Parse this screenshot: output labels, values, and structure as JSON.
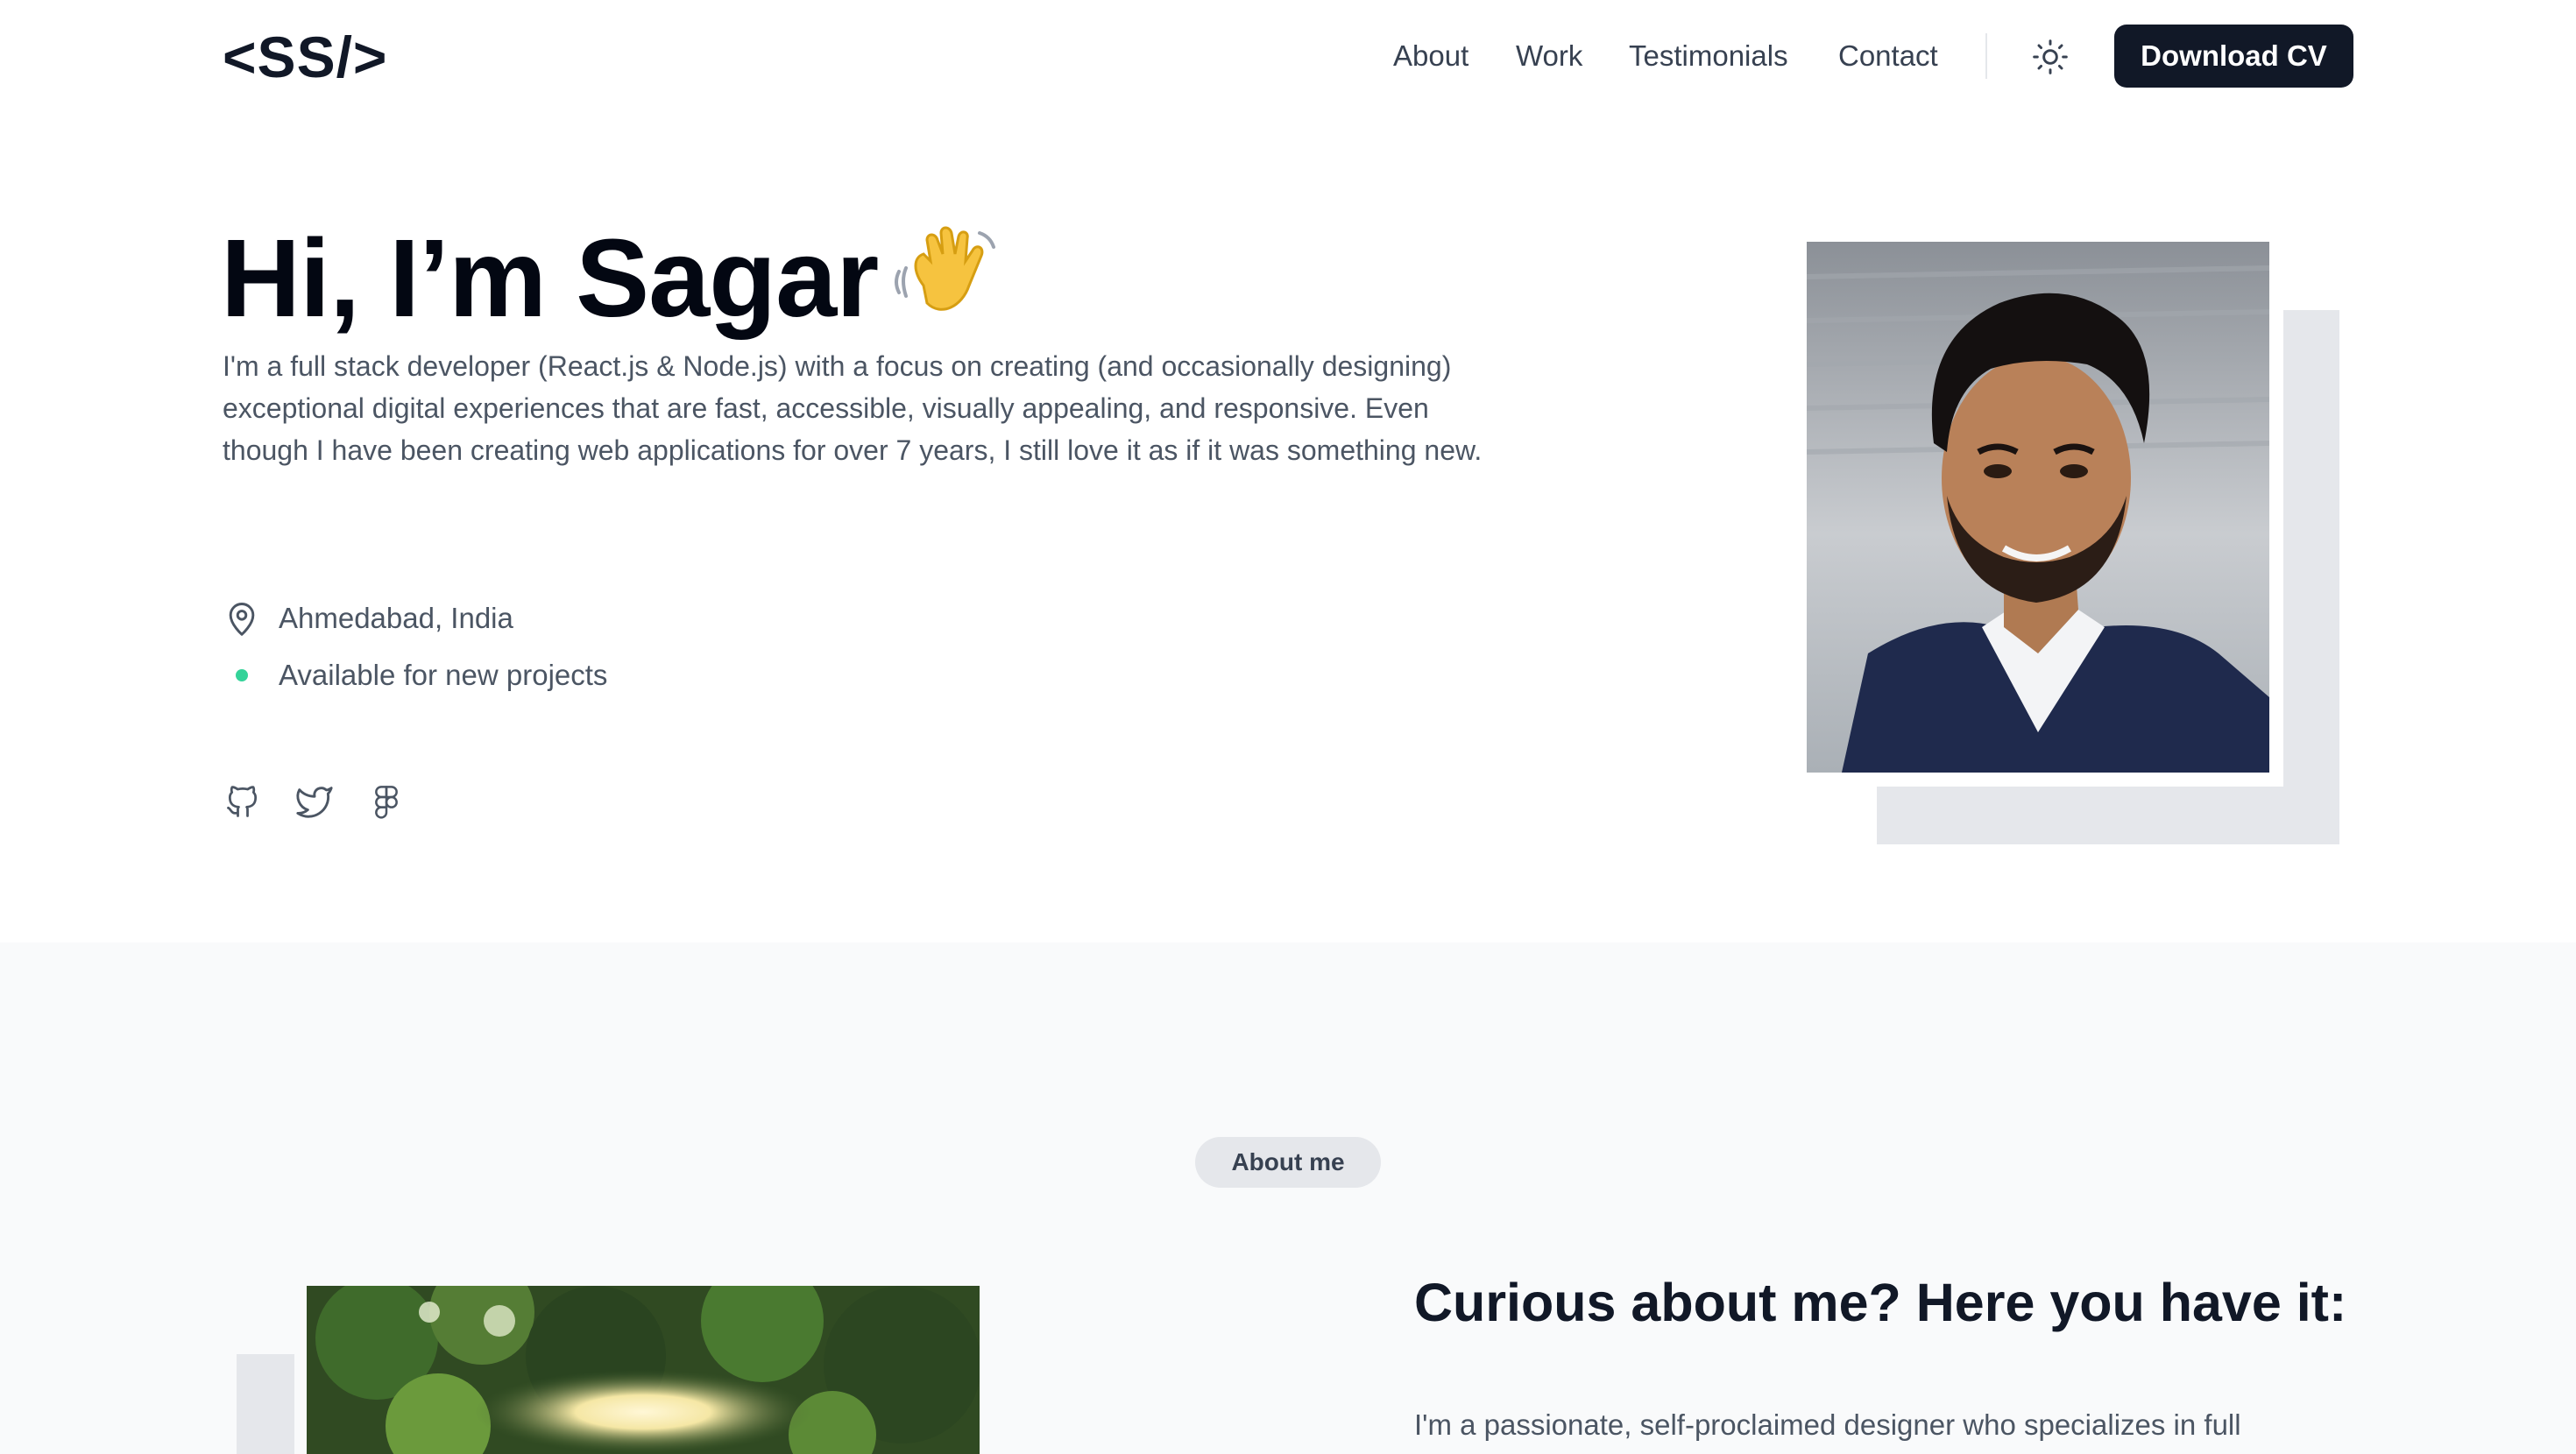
{
  "header": {
    "logo": "<SS/>",
    "nav": [
      {
        "label": "About"
      },
      {
        "label": "Work"
      },
      {
        "label": "Testimonials"
      },
      {
        "label": "Contact"
      }
    ],
    "theme_icon": "sun-icon",
    "cta_label": "Download CV"
  },
  "hero": {
    "title": "Hi, I’m Sagar",
    "emoji": "waving-hand",
    "description": "I'm a full stack developer (React.js & Node.js) with a focus on creating (and occasionally designing) exceptional digital experiences that are fast, accessible, visually appealing, and responsive. Even though I have been creating web applications for over 7 years, I still love it as if it was something new.",
    "location": "Ahmedabad, India",
    "availability": "Available for new projects",
    "socials": [
      "github-icon",
      "twitter-icon",
      "figma-icon"
    ]
  },
  "about": {
    "badge": "About me",
    "heading": "Curious about me? Here you have it:",
    "text": "I'm a passionate, self-proclaimed designer who specializes in full"
  },
  "colors": {
    "primary_dark": "#111827",
    "text_muted": "#4b5563",
    "available_dot": "#34d399",
    "section_bg": "#f9fafb",
    "badge_bg": "#e5e7eb"
  }
}
